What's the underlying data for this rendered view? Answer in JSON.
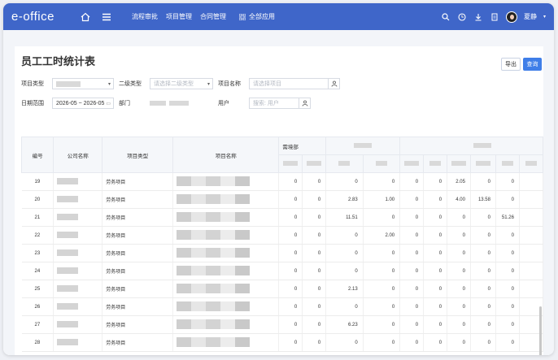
{
  "app": {
    "logo": "e-office"
  },
  "nav": {
    "items": [
      "流程审批",
      "项目管理",
      "合同管理"
    ],
    "apps_label": "全部应用"
  },
  "user": {
    "name": "夏静"
  },
  "page": {
    "title": "员工工时统计表",
    "export_label": "导出",
    "query_label": "查询"
  },
  "filters": {
    "project_type_label": "项目类型",
    "sub_type_label": "二级类型",
    "sub_type_placeholder": "请选择二级类型",
    "project_name_label": "项目名称",
    "project_name_placeholder": "请选择项目",
    "date_range_label": "日期范围",
    "date_range_value": "2026-05 ~ 2026-05",
    "dept_label": "部门",
    "user_label": "用户",
    "user_placeholder": "搜索: 用户"
  },
  "table": {
    "headers": {
      "no": "编号",
      "company": "公司名称",
      "type": "项目类型",
      "name": "项目名称",
      "dept": "需境部"
    },
    "rows": [
      {
        "no": "19",
        "type": "劳务项目",
        "v": [
          "0",
          "0",
          "0",
          "0",
          "0",
          "0",
          "2.05",
          "0",
          "0"
        ]
      },
      {
        "no": "20",
        "type": "劳务项目",
        "v": [
          "0",
          "0",
          "2.83",
          "1.00",
          "0",
          "0",
          "4.00",
          "13.58",
          "0"
        ]
      },
      {
        "no": "21",
        "type": "劳务项目",
        "v": [
          "0",
          "0",
          "11.51",
          "0",
          "0",
          "0",
          "0",
          "0",
          "51.26"
        ]
      },
      {
        "no": "22",
        "type": "劳务项目",
        "v": [
          "0",
          "0",
          "0",
          "2.00",
          "0",
          "0",
          "0",
          "0",
          "0"
        ]
      },
      {
        "no": "23",
        "type": "劳务项目",
        "v": [
          "0",
          "0",
          "0",
          "0",
          "0",
          "0",
          "0",
          "0",
          "0"
        ]
      },
      {
        "no": "24",
        "type": "劳务项目",
        "v": [
          "0",
          "0",
          "0",
          "0",
          "0",
          "0",
          "0",
          "0",
          "0"
        ]
      },
      {
        "no": "25",
        "type": "劳务项目",
        "v": [
          "0",
          "0",
          "2.13",
          "0",
          "0",
          "0",
          "0",
          "0",
          "0"
        ]
      },
      {
        "no": "26",
        "type": "劳务项目",
        "v": [
          "0",
          "0",
          "0",
          "0",
          "0",
          "0",
          "0",
          "0",
          "0"
        ]
      },
      {
        "no": "27",
        "type": "劳务项目",
        "v": [
          "0",
          "0",
          "6.23",
          "0",
          "0",
          "0",
          "0",
          "0",
          "0"
        ]
      },
      {
        "no": "28",
        "type": "劳务项目",
        "v": [
          "0",
          "0",
          "0",
          "0",
          "0",
          "0",
          "0",
          "0",
          "0"
        ]
      }
    ]
  }
}
